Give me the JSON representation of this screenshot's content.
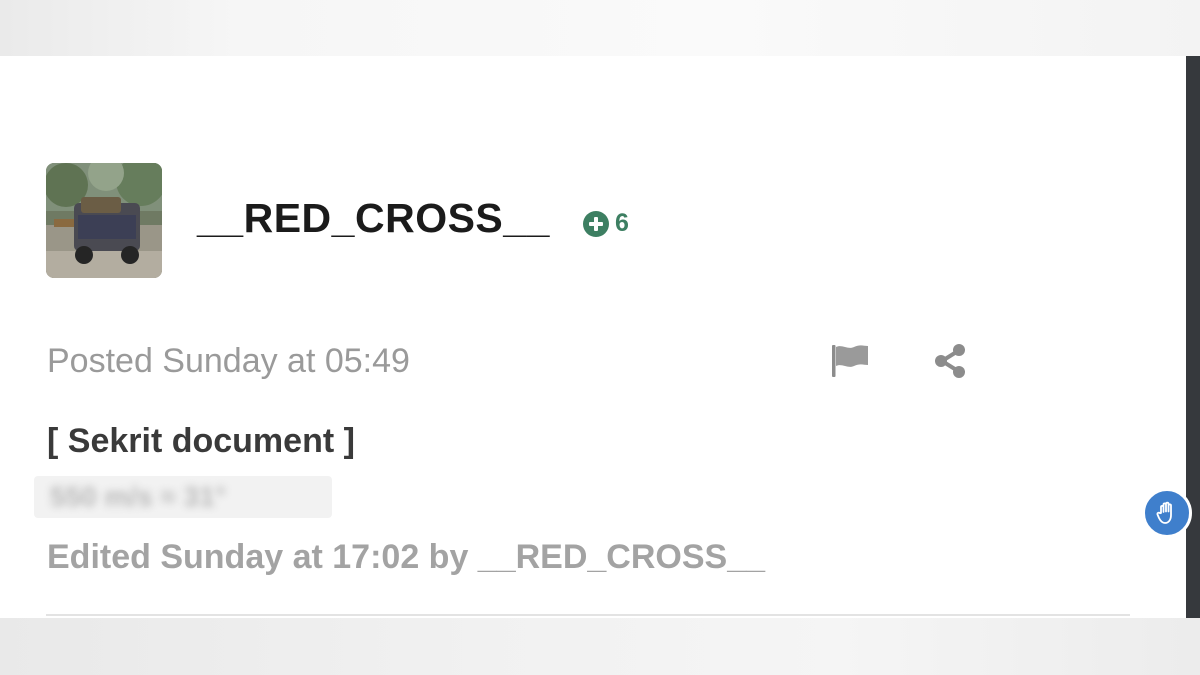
{
  "post": {
    "username": "__RED_CROSS__",
    "reputation": "6",
    "posted_text": "Posted Sunday at 05:49",
    "title": "[ Sekrit document ]",
    "blurred_line": "550 m/s ≈ 31°",
    "edited_text": "Edited Sunday at 17:02 by __RED_CROSS__"
  },
  "icons": {
    "reputation": "plus-circle-icon",
    "report": "flag-icon",
    "share": "share-icon",
    "floating": "hand-icon"
  },
  "colors": {
    "reputation": "#3d7f62",
    "floating_button": "#3f7fcc",
    "username": "#1b1b1b",
    "meta_text": "#9a9a9a"
  }
}
